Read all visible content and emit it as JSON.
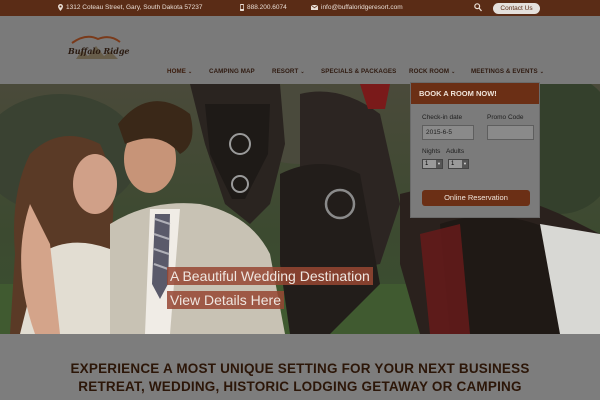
{
  "topbar": {
    "address": "1312 Coteau Street, Gary, South Dakota 57237",
    "phone": "888.200.6074",
    "email": "info@buffaloridgeresort.com",
    "contact_label": "Contact Us",
    "address_icon": "map-pin-icon",
    "phone_icon": "mobile-phone-icon",
    "email_icon": "envelope-icon",
    "search_icon": "search-icon"
  },
  "logo": {
    "text": "Buffalo Ridge"
  },
  "nav": {
    "items": [
      {
        "label": "HOME",
        "dropdown": true
      },
      {
        "label": "CAMPING MAP",
        "dropdown": false
      },
      {
        "label": "RESORT",
        "dropdown": true
      },
      {
        "label": "SPECIALS & PACKAGES",
        "dropdown": false
      },
      {
        "label": "ROCK ROOM",
        "dropdown": true
      },
      {
        "label": "MEETINGS & EVENTS",
        "dropdown": true
      }
    ]
  },
  "hero": {
    "caption_line1": "A Beautiful Wedding Destination",
    "caption_line2": "View Details Here"
  },
  "booking": {
    "title": "BOOK A ROOM NOW!",
    "checkin_label": "Check-in date",
    "checkin_value": "2015-6-5",
    "promo_label": "Promo Code",
    "promo_value": "",
    "nights_label": "Nights",
    "adults_label": "Adults",
    "nights_value": "1",
    "adults_value": "1",
    "button_label": "Online Reservation"
  },
  "main": {
    "headline_line1": "EXPERIENCE A MOST UNIQUE SETTING FOR YOUR NEXT BUSINESS",
    "headline_line2": "RETREAT, WEDDING, HISTORIC LODGING GETAWAY OR CAMPING"
  },
  "colors": {
    "brand_brown": "#5a2c16",
    "button_brown": "#6b2f15",
    "overlay_gray": "#7b7b7b",
    "caption_red": "#964632"
  }
}
